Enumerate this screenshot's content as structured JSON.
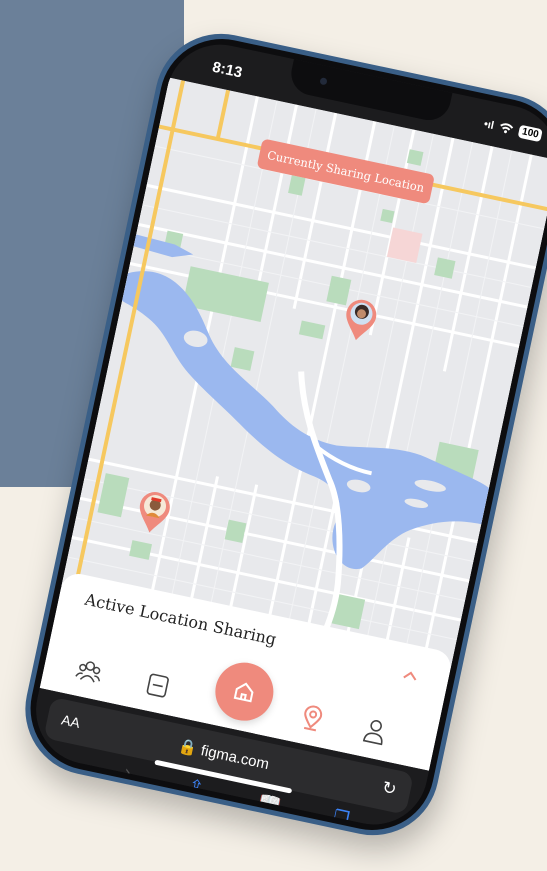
{
  "status": {
    "time": "8:13",
    "signal": "•ıl",
    "wifi": "wifi-icon",
    "battery": "100"
  },
  "banner": {
    "label": "Currently Sharing Location"
  },
  "sheet": {
    "title": "Active Location Sharing"
  },
  "tabs": [
    "friends-icon",
    "notes-icon",
    "home-icon",
    "location-pin-icon",
    "profile-icon"
  ],
  "browser": {
    "text_size": "AA",
    "url": "figma.com"
  },
  "colors": {
    "accent": "#ef8a7d",
    "water": "#9bb8ef",
    "park": "#b9dcbc",
    "road": "#f6c85f",
    "background_panel": "#6b8099",
    "background": "#f4efe6",
    "frame": "#3a5f87"
  }
}
